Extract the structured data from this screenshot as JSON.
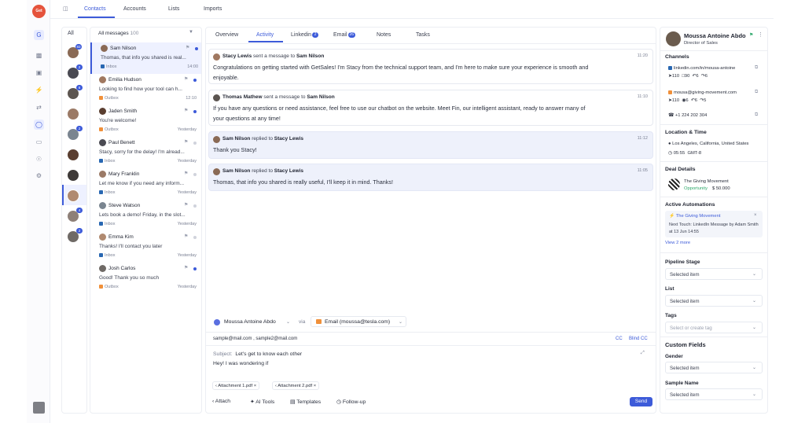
{
  "app": {
    "logo_text": "Get"
  },
  "top_tabs": [
    {
      "label": "Contacts",
      "active": true
    },
    {
      "label": "Accounts",
      "active": false
    },
    {
      "label": "Lists",
      "active": false
    },
    {
      "label": "Imports",
      "active": false
    }
  ],
  "rail_icons": [
    "grid-icon",
    "bar-chart-icon",
    "briefcase-icon",
    "lightning-icon",
    "shuffle-icon",
    "chat-icon",
    "clipboard-icon",
    "users-icon",
    "gear-icon"
  ],
  "filter_panel": {
    "all_label": "All",
    "avatar_badges": [
      "83",
      "2",
      "6",
      "",
      "2",
      "",
      "",
      "",
      "4",
      "2"
    ]
  },
  "message_list": {
    "header": "All messages",
    "count": "100",
    "items": [
      {
        "name": "Sam Nilson",
        "message": "Thomas, that info you shared is real...",
        "source": "Inbox",
        "time": "14:00",
        "source_type": "linkedin",
        "unread": true
      },
      {
        "name": "Emilia Hudson",
        "message": "Looking to find how your tool can h...",
        "source": "Outbox",
        "time": "12:10",
        "source_type": "email",
        "unread": true
      },
      {
        "name": "Jaden Smith",
        "message": "You're welcome!",
        "source": "Outbox",
        "time": "Yesterday",
        "source_type": "email",
        "unread": true
      },
      {
        "name": "Paul Benett",
        "message": "Stacy, sorry for the delay! I'm alread...",
        "source": "Inbox",
        "time": "Yesterday",
        "source_type": "linkedin",
        "unread": false
      },
      {
        "name": "Mary Franklin",
        "message": "Let me know if you need any inform...",
        "source": "Inbox",
        "time": "Yesterday",
        "source_type": "linkedin",
        "unread": false
      },
      {
        "name": "Steve Watson",
        "message": "Lets book a demo! Friday, in the slot...",
        "source": "Inbox",
        "time": "Yesterday",
        "source_type": "linkedin",
        "unread": false
      },
      {
        "name": "Emma Kim",
        "message": "Thanks! I'll contact you later",
        "source": "Inbox",
        "time": "Yesterday",
        "source_type": "linkedin",
        "unread": false
      },
      {
        "name": "Josh Carlos",
        "message": "Good! Thank you so much",
        "source": "Outbox",
        "time": "Yesterday",
        "source_type": "email",
        "unread": true
      }
    ]
  },
  "conversation": {
    "tabs": [
      {
        "label": "Overview",
        "badge": ""
      },
      {
        "label": "Activity",
        "badge": ""
      },
      {
        "label": "Linkedin",
        "badge": "2"
      },
      {
        "label": "Email",
        "badge": "26"
      },
      {
        "label": "Notes",
        "badge": ""
      },
      {
        "label": "Tasks",
        "badge": ""
      }
    ],
    "messages": [
      {
        "from": "Stacy Lewis",
        "verb": "sent a message to",
        "to": "Sam Nilson",
        "time": "11:20",
        "reply": false,
        "lines": [
          "Congratulations on getting started with GetSales! I'm Stacy from the technical support team, and I'm here to make sure your experience is smooth and",
          "enjoyable."
        ]
      },
      {
        "from": "Thomas Mathew",
        "verb": "sent a message to",
        "to": "Sam Nilson",
        "time": "11:10",
        "reply": false,
        "lines": [
          "If you have any questions or need assistance, feel free to use our chatbot on the website. Meet Fin, our intelligent assistant, ready to answer many of",
          "your questions at any time!"
        ]
      },
      {
        "from": "Sam Nilson",
        "verb": "replied to",
        "to": "Stacy Lewis",
        "time": "11:12",
        "reply": true,
        "lines": [
          "Thank you Stacy!"
        ]
      },
      {
        "from": "Sam Nilson",
        "verb": "replied to",
        "to": "Stacy Lewis",
        "time": "11:05",
        "reply": true,
        "lines": [
          "Thomas, that info you shared is really useful, I'll keep it in mind. Thanks!"
        ]
      }
    ]
  },
  "composer": {
    "from_name": "Moussa Antoine Abdo",
    "via": "via",
    "channel": "Email (moussa@tesla.com)",
    "to": "sample@mail.com ,  sample2@mail.com",
    "cc": "CC",
    "bcc": "Blind CC",
    "subject_label": "Subject:",
    "subject": "Let's get to know each other",
    "body": "Hey! I was wondering if",
    "attachments": [
      "Attachment 1.pdf",
      "Attachment 2.pdf"
    ],
    "tools": [
      "Attach",
      "AI Tools",
      "Templates",
      "Follow-up"
    ],
    "send_label": "Send"
  },
  "contact": {
    "name": "Moussa Antoine Abdo",
    "role": "Director of Sales",
    "channels_title": "Channels",
    "linkedin": "linkedin.com/in/mousa-antoine",
    "linkedin_stats": [
      "110",
      "90",
      "6",
      "6"
    ],
    "email": "mousa@giving-movement.com",
    "email_stats": [
      "110",
      "6",
      "6",
      "5"
    ],
    "phone": "+1 224 202 304",
    "location_title": "Location & Time",
    "location": "Los Angeles, California, United States",
    "time": "05:55",
    "timezone": "GMT-8",
    "deal_title": "Deal Details",
    "deal_name": "The Giving Movement",
    "deal_stage": "Opportunity",
    "deal_amount": "$ 50.000",
    "automations_title": "Active Automations",
    "automation_name": "The Giving Movement",
    "automation_desc": "Next Touch: LinkedIn Message by Adam Smith at 13 Jun 14:55",
    "view_more": "View 2 more",
    "pipeline_label": "Pipeline Stage",
    "pipeline_value": "Selected item",
    "list_label": "List",
    "list_value": "Selected item",
    "tags_label": "Tags",
    "tags_placeholder": "Select or create tag",
    "custom_fields_title": "Custom Fields",
    "gender_label": "Gender",
    "gender_value": "Selected item",
    "sample_label": "Sample Name",
    "sample_value": "Selected item"
  },
  "colors": {
    "accent": "#3d5bd9",
    "logo": "#e5533c",
    "success": "#2ea86b",
    "email": "#f0903a",
    "linkedin": "#2867b2"
  }
}
